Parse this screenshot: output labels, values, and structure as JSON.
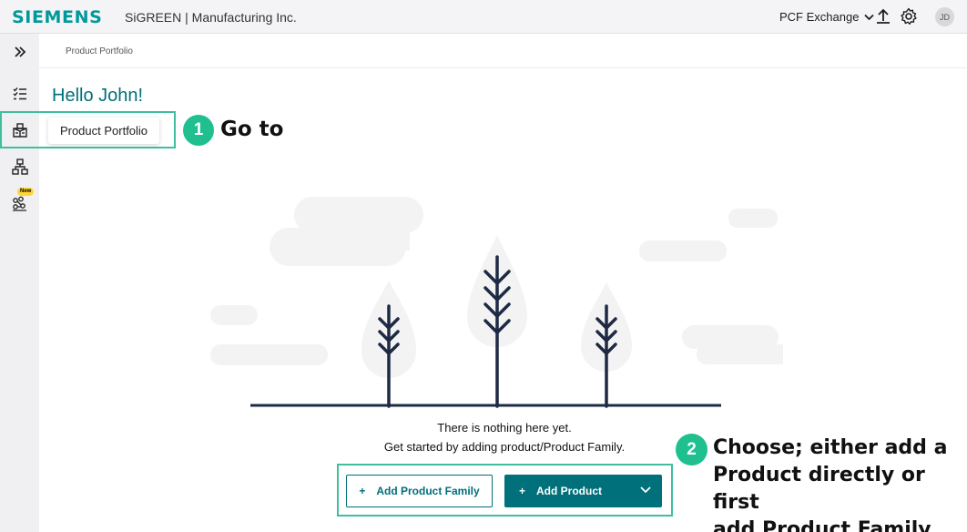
{
  "header": {
    "logo": "SIEMENS",
    "company": "SiGREEN | Manufacturing Inc.",
    "pcf_exchange": "PCF Exchange",
    "upload_icon": "upload-icon",
    "settings_icon": "gear-icon",
    "avatar_initials": "JD"
  },
  "sidebar": {
    "expand_icon": "double-chevron-right-icon",
    "items": [
      {
        "icon": "checklist-icon"
      },
      {
        "icon": "product-portfolio-icon"
      },
      {
        "icon": "hierarchy-icon"
      },
      {
        "icon": "people-network-icon",
        "badge": "New"
      }
    ]
  },
  "breadcrumb": "Product Portfolio",
  "greeting": "Hello John!",
  "tooltip": "Product Portfolio",
  "annotations": {
    "step1_number": "1",
    "step1_text": "Go to",
    "step2_number": "2",
    "step2_lines": [
      "Choose; either add a",
      "Product directly or first",
      "add Product Family"
    ]
  },
  "empty_state": {
    "line1": "There is nothing here yet.",
    "line2": "Get started by adding product/Product Family."
  },
  "buttons": {
    "add_family": "Add Product Family",
    "add_product": "Add Product"
  },
  "colors": {
    "brand": "#009999",
    "primary": "#00707a",
    "highlight": "#3fbf9e",
    "step": "#1fbf8f",
    "badge": "#ffd732"
  }
}
